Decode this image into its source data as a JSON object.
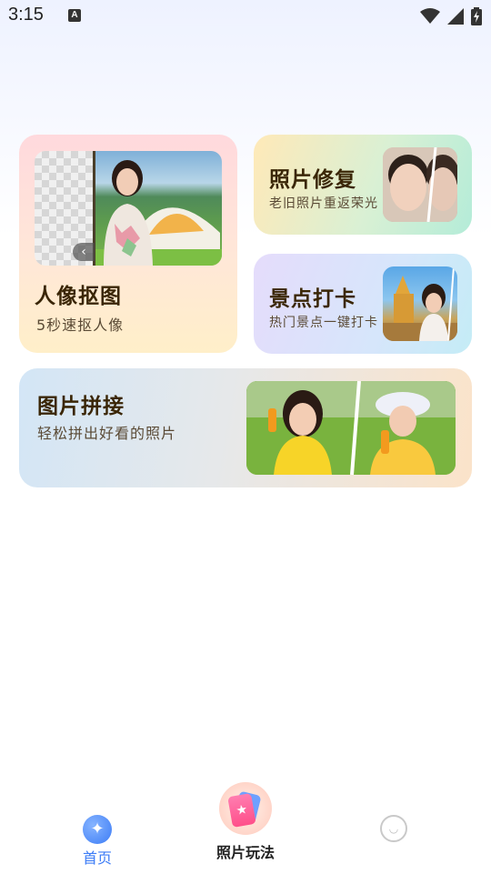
{
  "status_bar": {
    "time": "3:15",
    "notification_icon": "a-icon",
    "icons": [
      "wifi-icon",
      "signal-icon",
      "battery-charging-icon"
    ]
  },
  "cards": {
    "portrait": {
      "title": "人像抠图",
      "subtitle": "5秒速抠人像"
    },
    "repair": {
      "title": "照片修复",
      "subtitle": "老旧照片重返荣光"
    },
    "scenic": {
      "title": "景点打卡",
      "subtitle": "热门景点一键打卡"
    },
    "stitch": {
      "title": "图片拼接",
      "subtitle": "轻松拼出好看的照片"
    }
  },
  "bottom_nav": {
    "home_label": "首页",
    "play_label": "照片玩法",
    "active_color": "#3c7cf6"
  },
  "colors": {
    "title_text": "#3a2606",
    "portrait_card": "#ffe2dc",
    "repair_card": "#c9f0dc",
    "scenic_card": "#dcdffb",
    "stitch_card": "#e3e8ee"
  }
}
